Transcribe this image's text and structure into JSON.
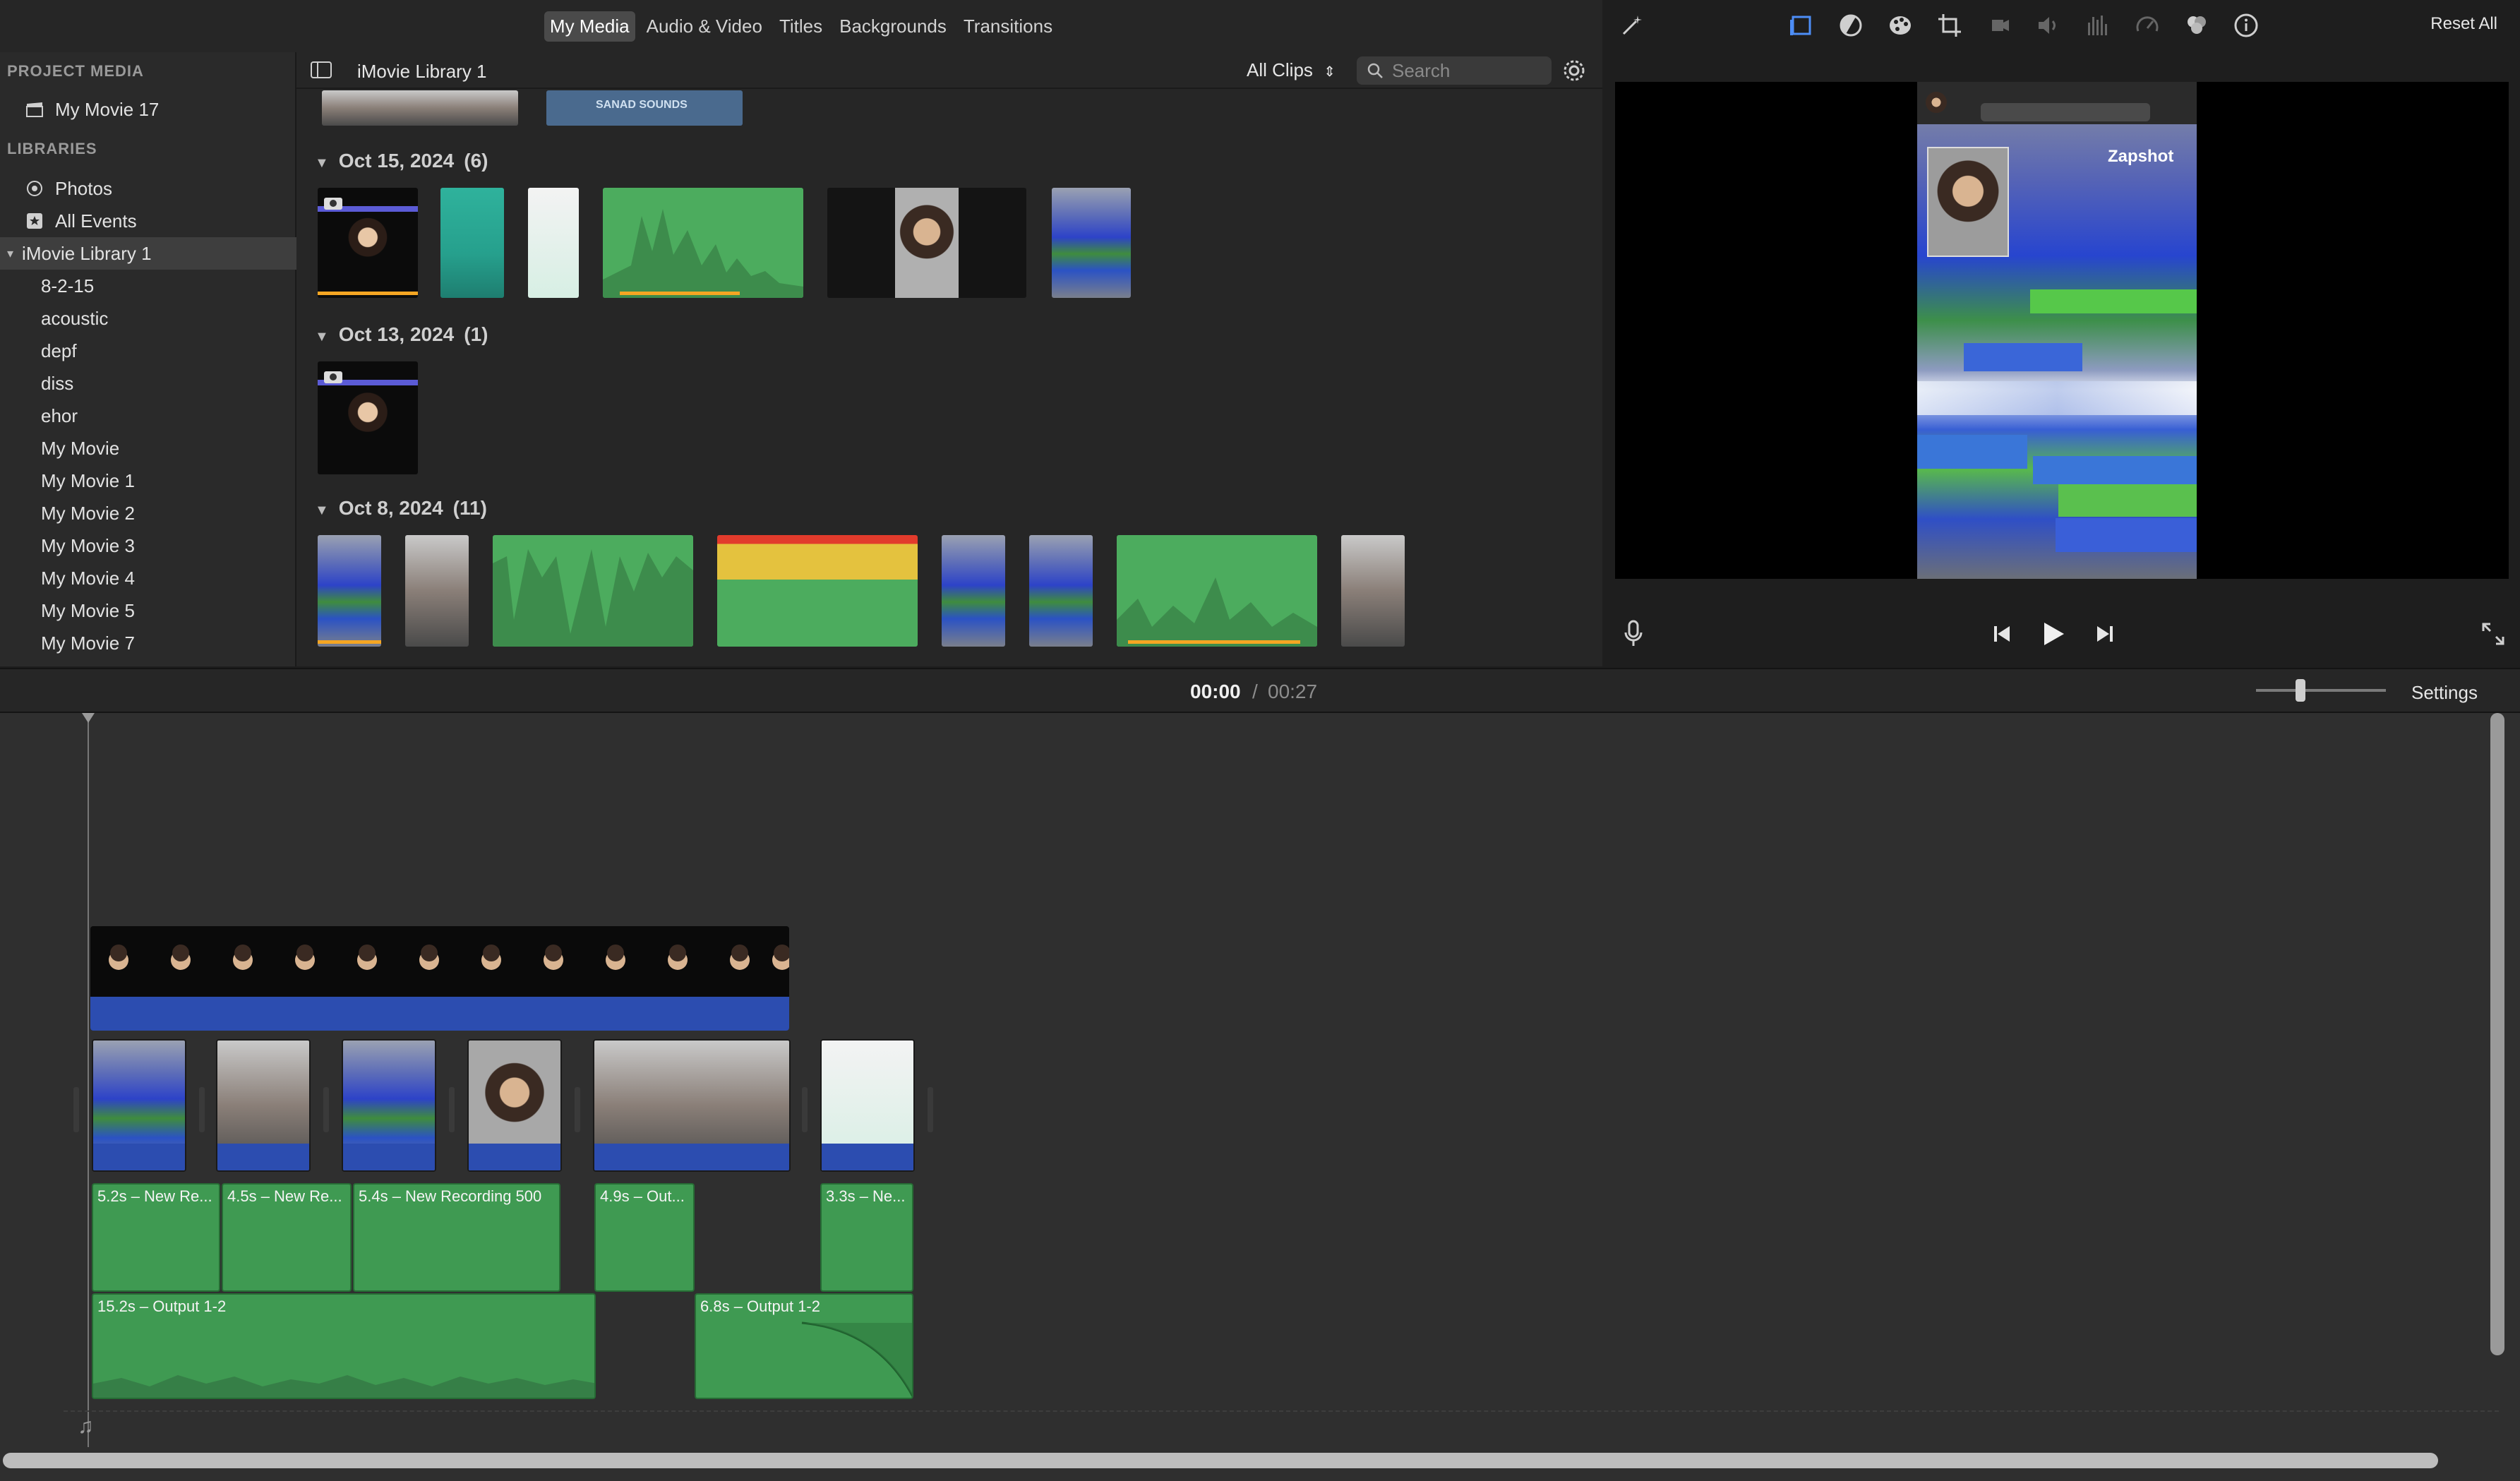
{
  "nav": {
    "tabs": [
      "My Media",
      "Audio & Video",
      "Titles",
      "Backgrounds",
      "Transitions"
    ],
    "active": "My Media"
  },
  "sidebar": {
    "project_heading": "PROJECT MEDIA",
    "project_item": "My Movie 17",
    "libraries_heading": "LIBRARIES",
    "photos": "Photos",
    "all_events": "All Events",
    "library": "iMovie Library 1",
    "events": [
      "8-2-15",
      "acoustic",
      "depf",
      "diss",
      "ehor",
      "My Movie",
      "My Movie 1",
      "My Movie 2",
      "My Movie 3",
      "My Movie 4",
      "My Movie 5",
      "My Movie 7"
    ]
  },
  "browser": {
    "library_title": "iMovie Library 1",
    "clip_filter": "All Clips",
    "search_placeholder": "Search",
    "events": [
      {
        "date": "Oct 15, 2024",
        "count": "(6)"
      },
      {
        "date": "Oct 13, 2024",
        "count": "(1)"
      },
      {
        "date": "Oct 8, 2024",
        "count": "(11)"
      }
    ],
    "top_thumb_text": "SANAD SOUNDS"
  },
  "viewer": {
    "reset_label": "Reset All",
    "preview_brand": "Zapshot"
  },
  "timeline": {
    "current": "00:00",
    "separator": "/",
    "total": "00:27",
    "settings_label": "Settings",
    "audio_clips": [
      "5.2s – New Re...",
      "4.5s – New Re...",
      "5.4s – New Recording 500",
      "4.9s – Out...",
      "3.3s – Ne...",
      "15.2s – Output 1-2",
      "6.8s – Output 1-2"
    ]
  },
  "colors": {
    "audio_green": "#3f9a52",
    "video_blue": "#2c4db0",
    "accent_blue": "#4d8ef7",
    "orange": "#f5a623"
  }
}
